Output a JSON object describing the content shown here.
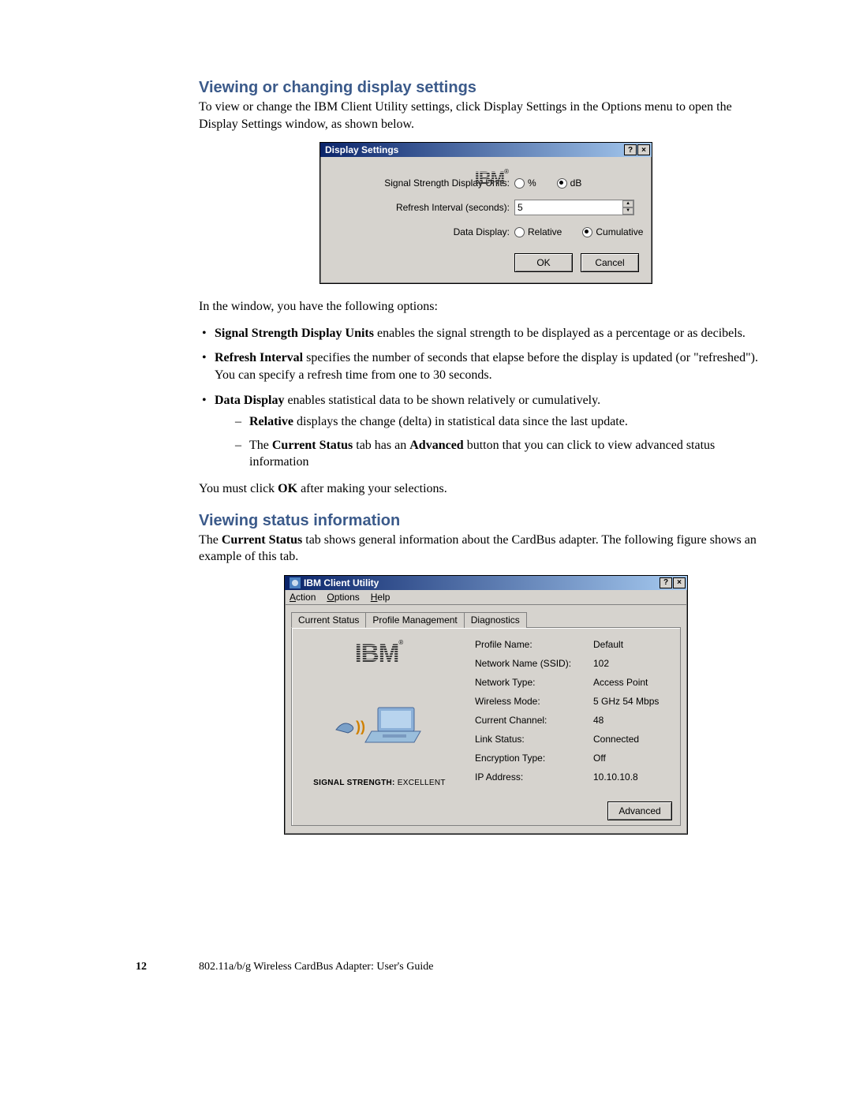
{
  "sections": {
    "viewing_display": {
      "title": "Viewing or changing display settings",
      "intro": "To view or change the IBM Client Utility settings, click Display Settings in the Options menu to open the Display Settings window, as shown below.",
      "after_dialog": "In the window, you have the following options:",
      "bullets": {
        "b1_bold": "Signal Strength Display Units",
        "b1_rest": " enables the signal strength to be displayed as a percentage or as decibels.",
        "b2_bold": "Refresh Interval",
        "b2_rest": " specifies the number of seconds that elapse before the display is updated (or \"refreshed\"). You can specify a refresh time from one to 30 seconds.",
        "b3_bold": "Data Display",
        "b3_rest": " enables statistical data to be shown relatively or cumulatively.",
        "sub1_bold": "Relative",
        "sub1_rest": " displays the change (delta) in statistical data since the last update.",
        "sub2_pre": "The ",
        "sub2_bold1": "Current Status",
        "sub2_mid": " tab has an ",
        "sub2_bold2": "Advanced",
        "sub2_rest": " button that you can click to view advanced status information"
      },
      "ok_note_pre": "You must click ",
      "ok_note_bold": "OK",
      "ok_note_post": " after making your selections."
    },
    "viewing_status": {
      "title": "Viewing status information",
      "intro_pre": "The ",
      "intro_bold": "Current Status",
      "intro_post": " tab shows general information about the CardBus adapter. The following figure shows an example of this tab."
    }
  },
  "display_settings_dialog": {
    "title": "Display Settings",
    "labels": {
      "signal": "Signal Strength Display Units:",
      "refresh": "Refresh Interval (seconds):",
      "data": "Data Display:"
    },
    "radios": {
      "percent": "%",
      "db": "dB",
      "relative": "Relative",
      "cumulative": "Cumulative"
    },
    "refresh_value": "5",
    "ok": "OK",
    "cancel": "Cancel",
    "help": "?",
    "close": "×"
  },
  "client_utility_dialog": {
    "title": "IBM Client Utility",
    "menu": {
      "action": "Action",
      "options": "Options",
      "help": "Help"
    },
    "tabs": {
      "current": "Current Status",
      "profile": "Profile Management",
      "diag": "Diagnostics"
    },
    "fields": {
      "profile_name": {
        "k": "Profile Name:",
        "v": "Default"
      },
      "ssid": {
        "k": "Network Name (SSID):",
        "v": "102"
      },
      "ntype": {
        "k": "Network Type:",
        "v": "Access Point"
      },
      "wmode": {
        "k": "Wireless Mode:",
        "v": "5 GHz 54 Mbps"
      },
      "channel": {
        "k": "Current Channel:",
        "v": "48"
      },
      "link": {
        "k": "Link Status:",
        "v": "Connected"
      },
      "enc": {
        "k": "Encryption Type:",
        "v": "Off"
      },
      "ip": {
        "k": "IP Address:",
        "v": "10.10.10.8"
      }
    },
    "signal_strength_label": "SIGNAL STRENGTH:",
    "signal_strength_value": "EXCELLENT",
    "advanced": "Advanced",
    "help": "?",
    "close": "×"
  },
  "footer": {
    "page": "12",
    "title": "802.11a/b/g Wireless CardBus Adapter: User's Guide"
  },
  "ibm_logo_text": "IBM"
}
